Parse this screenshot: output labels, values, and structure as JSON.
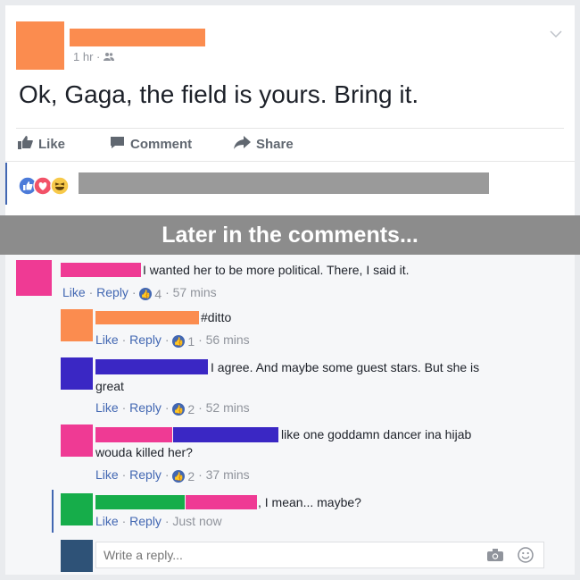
{
  "post": {
    "time": "1 hr",
    "separator": "·",
    "audience_icon": "friends-icon",
    "text": "Ok, Gaga, the field is yours. Bring it.",
    "chevron_icon": "chevron-down-icon"
  },
  "actions": {
    "like": "Like",
    "comment": "Comment",
    "share": "Share"
  },
  "reactions": {
    "icons": [
      "like-icon",
      "love-icon",
      "haha-icon"
    ]
  },
  "banner": {
    "text": "Later in the comments..."
  },
  "comments": [
    {
      "text": "I wanted her to be more political. There, I said it.",
      "like": "Like",
      "reply": "Reply",
      "count": "4",
      "time": "57 mins"
    },
    {
      "text": "#ditto",
      "like": "Like",
      "reply": "Reply",
      "count": "1",
      "time": "56 mins"
    },
    {
      "text": "I agree. And maybe some guest stars. But she is",
      "text2": "great",
      "like": "Like",
      "reply": "Reply",
      "count": "2",
      "time": "52 mins"
    },
    {
      "text": "like one goddamn dancer ina hijab",
      "text2": "wouda killed her?",
      "like": "Like",
      "reply": "Reply",
      "count": "2",
      "time": "37 mins"
    },
    {
      "text": ", I mean... maybe?",
      "like": "Like",
      "reply": "Reply",
      "time": "Just now"
    }
  ],
  "reply_box": {
    "placeholder": "Write a reply...",
    "camera_icon": "camera-icon",
    "emoji_icon": "emoji-icon"
  },
  "colors": {
    "orange": "#fb8c4f",
    "pink": "#ef3a94",
    "purple": "#3a27c4",
    "green": "#16ad4a",
    "navy": "#2e5277",
    "gray_block": "#9a9a9a",
    "banner_bg": "#8c8c8c",
    "fb_blue": "#4267b2"
  }
}
